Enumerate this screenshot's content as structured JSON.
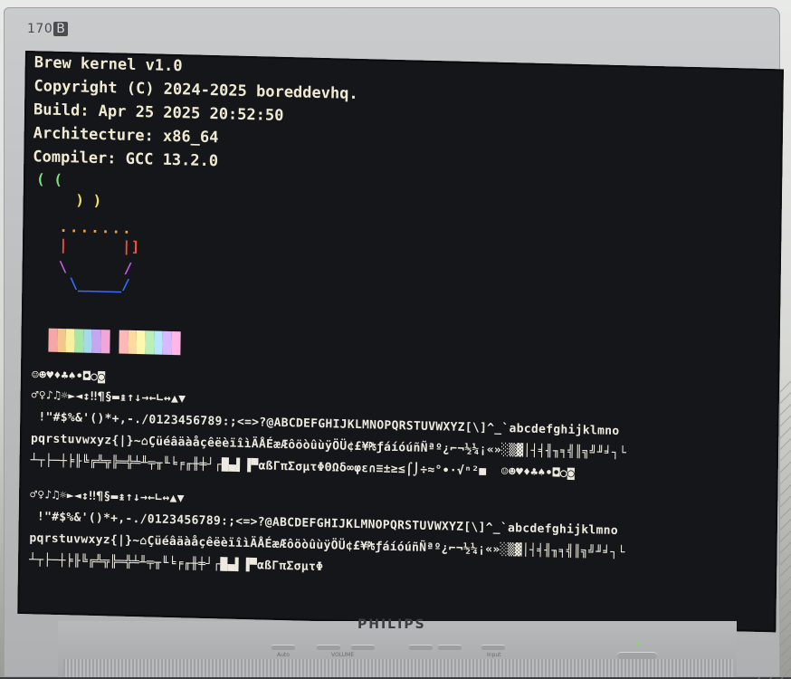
{
  "monitor": {
    "model": "170",
    "model_suffix": "B",
    "brand": "PHILIPS",
    "button_labels": [
      "Auto",
      "VOLUME",
      "",
      "Input"
    ]
  },
  "terminal": {
    "lines": [
      "Brew kernel v1.0",
      "Copyright (C) 2024-2025 boreddevhq.",
      "Build: Apr 25 2025 20:52:50",
      "Architecture: x86_64",
      "Compiler: GCC 13.2.0"
    ],
    "logo": {
      "steam1": "( (",
      "steam2": " ) )",
      "rim": ".......",
      "cup_left": "|",
      "cup_right": "|]",
      "base_left": "\\",
      "base_right": "/",
      "bottom": "\\_____/"
    },
    "palette_dark": [
      "#f6a6a6",
      "#f3c78a",
      "#f6f0a0",
      "#a6e6a6",
      "#a6d8f0",
      "#c6a6f0",
      "#f0a6d6"
    ],
    "palette_light": [
      "#ffb8b8",
      "#ffd8a0",
      "#fff6b0",
      "#b8f0b8",
      "#b8e6ff",
      "#d8b8ff",
      "#ffb8e6"
    ],
    "charset_rows": [
      "☺☻♥♦♣♠•◘○◙",
      "♂♀♪♫☼►◄↕‼¶§▬↨↑↓→←∟↔▲▼",
      " !\"#$%&'()*+,-./0123456789:;<=>?@ABCDEFGHIJKLMNOPQRSTUVWXYZ[\\]^_`abcdefghijklmno",
      "pqrstuvwxyz{|}~⌂ÇüéâäàåçêëèïîìÄÅÉæÆôöòûùÿÖÜ¢£¥₧ƒáíóúñÑªº¿⌐¬½¼¡«»░▒▓│┤╡╢╖╕╣║╗╝╜╛┐└",
      "┴┬├─┼╞╟╚╔╩╦╠═╬╧╨╤╥╙╘╒╓╫╪┘┌█▄▌▐▀αßΓπΣσµτΦΘΩδ∞φε∩≡±≥≤⌠⌡÷≈°∙·√ⁿ²■  ☺☻♥♦♣♠•◘○◙",
      "♂♀♪♫☼►◄↕‼¶§▬↨↑↓→←∟↔▲▼",
      " !\"#$%&'()*+,-./0123456789:;<=>?@ABCDEFGHIJKLMNOPQRSTUVWXYZ[\\]^_`abcdefghijklmno",
      "pqrstuvwxyz{|}~⌂ÇüéâäàåçêëèïîìÄÅÉæÆôöòûùÿÖÜ¢£¥₧ƒáíóúñÑªº¿⌐¬½¼¡«»░▒▓│┤╡╢╖╕╣║╗╝╜╛┐└",
      "┴┬├─┼╞╟╚╔╩╦╠═╬╧╨╤╥╙╘╒╓╫╪┘┌█▄▌▐▀αßΓπΣσµτΦ"
    ]
  }
}
